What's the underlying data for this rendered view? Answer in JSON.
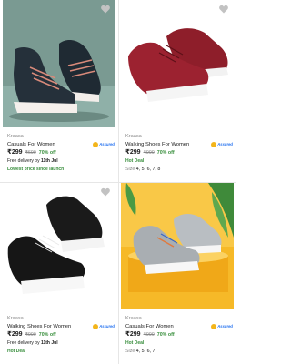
{
  "colors": {
    "assured_blue": "#2874f0",
    "green": "#388e3c",
    "grey": "#878787"
  },
  "products": [
    {
      "brand": "Kraasa",
      "title": "Casuals For Women",
      "assured_label": "Assured",
      "price": "₹299",
      "mrp": "₹699",
      "discount": "70% off",
      "delivery_prefix": "Free delivery by",
      "delivery_date": "11th Jul",
      "tag": "Lowest price since launch"
    },
    {
      "brand": "Kraasa",
      "title": "Walking Shoes For Women",
      "assured_label": "Assured",
      "price": "₹299",
      "mrp": "₹999",
      "discount": "70% off",
      "tag": "Hot Deal",
      "size_label": "Size",
      "sizes": "4, 5, 6, 7, 8"
    },
    {
      "brand": "Kraasa",
      "title": "Walking Shoes For Women",
      "assured_label": "Assured",
      "price": "₹299",
      "mrp": "₹999",
      "discount": "70% off",
      "delivery_prefix": "Free delivery by",
      "delivery_date": "11th Jul",
      "tag": "Hot Deal"
    },
    {
      "brand": "Kraasa",
      "title": "Casuals For Women",
      "assured_label": "Assured",
      "price": "₹299",
      "mrp": "₹999",
      "discount": "70% off",
      "tag": "Hot Deal",
      "size_label": "Size",
      "sizes": "4, 5, 6, 7"
    }
  ]
}
